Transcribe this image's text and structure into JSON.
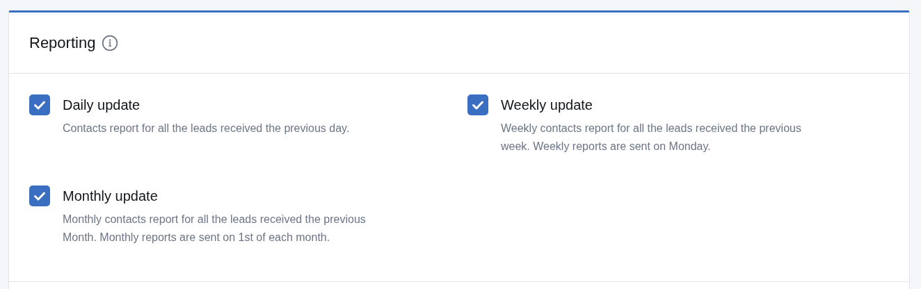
{
  "panel": {
    "title": "Reporting"
  },
  "options": [
    {
      "label": "Daily update",
      "checked": true,
      "description_lines": [
        "Contacts report for all the leads received the previous day."
      ]
    },
    {
      "label": "Weekly update",
      "checked": true,
      "description_lines": [
        "Weekly contacts report for all the leads received the previous",
        "week. Weekly reports are sent on Monday."
      ]
    },
    {
      "label": "Monthly update",
      "checked": true,
      "description_lines": [
        "Monthly contacts report for all the leads received the previous",
        "Month. Monthly reports are sent on 1st of each month."
      ]
    }
  ]
}
